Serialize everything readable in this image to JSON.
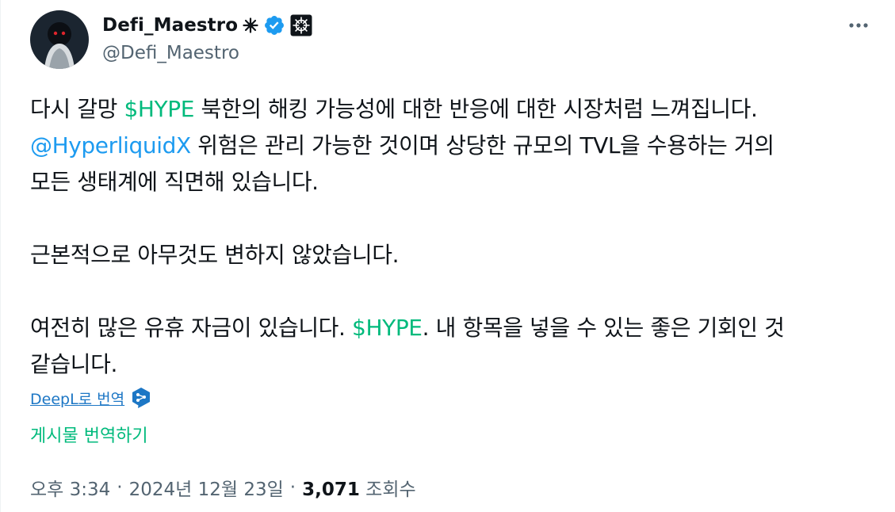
{
  "author": {
    "display_name": "Defi_Maestro",
    "handle": "@Defi_Maestro",
    "badges": [
      "sparkle-icon",
      "verified-badge-icon",
      "affiliate-logo-icon"
    ]
  },
  "menu": {
    "more_label": "•••"
  },
  "tweet": {
    "paragraphs": [
      {
        "lines": [
          [
            {
              "text": "다시 갈망 ",
              "type": "text"
            },
            {
              "text": "$HYPE",
              "type": "cashtag"
            },
            {
              "text": " 북한의 해킹 가능성에 대한 반응에 대한 시장처럼 느껴집니다.",
              "type": "text"
            }
          ],
          [
            {
              "text": "@HyperliquidX",
              "type": "mention"
            },
            {
              "text": " 위험은 관리 가능한 것이며 상당한 규모의 TVL을 수용하는 거의",
              "type": "text"
            }
          ],
          [
            {
              "text": "모든 생태계에 직면해 있습니다.",
              "type": "text"
            }
          ]
        ]
      },
      {
        "lines": [
          [
            {
              "text": "근본적으로 아무것도 변하지 않았습니다.",
              "type": "text"
            }
          ]
        ]
      },
      {
        "lines": [
          [
            {
              "text": "여전히 많은 유휴 자금이 있습니다. ",
              "type": "text"
            },
            {
              "text": "$HYPE",
              "type": "cashtag"
            },
            {
              "text": ". 내 항목을 넣을 수 있는 좋은 기회인 것",
              "type": "text"
            }
          ],
          [
            {
              "text": "같습니다.",
              "type": "text"
            }
          ]
        ]
      }
    ]
  },
  "translation": {
    "deepl_label": "DeepL로 번역",
    "translate_post_label": "게시물 번역하기"
  },
  "meta": {
    "time": "오후 3:34",
    "separator": "·",
    "date": "2024년 12월 23일",
    "views_count": "3,071",
    "views_label": "조회수"
  },
  "colors": {
    "cashtag": "#00ba7c",
    "mention": "#1d9bf0",
    "verified": "#1d9bf0",
    "secondary_text": "#536471",
    "primary_text": "#0f1419"
  }
}
